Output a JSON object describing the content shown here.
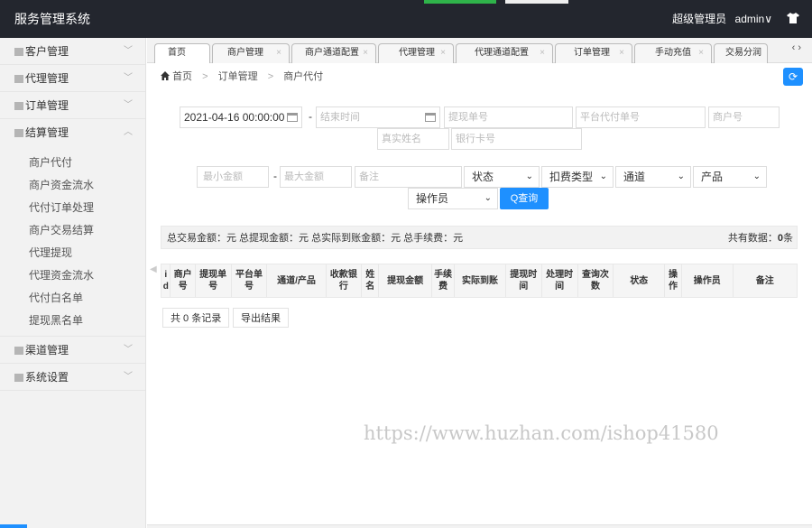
{
  "header": {
    "title": "服务管理系统",
    "user": "超级管理员",
    "username": "admin∨",
    "shirt_icon": "shirt-icon"
  },
  "sidebar": {
    "groups": [
      {
        "label": "客户管理"
      },
      {
        "label": "代理管理"
      },
      {
        "label": "订单管理"
      },
      {
        "label": "结算管理"
      },
      {
        "label": "渠道管理"
      },
      {
        "label": "系统设置"
      }
    ],
    "sub_items": [
      "商户代付",
      "商户资金流水",
      "代付订单处理",
      "商户交易结算",
      "代理提现",
      "代理资金流水",
      "代付白名单",
      "提现黑名单"
    ]
  },
  "tabs": [
    "首页",
    "商户管理",
    "商户通道配置",
    "代理管理",
    "代理通道配置",
    "订单管理",
    "手动充值",
    "交易分润"
  ],
  "tab_nav": "‹  ›",
  "breadcrumb": {
    "home": "首页",
    "sep": ">",
    "level1": "订单管理",
    "level2": "商户代付"
  },
  "filters": {
    "start_time": "2021-04-16 00:00:00",
    "end_time_placeholder": "结束时间",
    "withdraw_no": "提现单号",
    "platform_no": "平台代付单号",
    "merchant_no": "商户号",
    "real_name": "真实姓名",
    "bank_card": "银行卡号",
    "min_amount": "最小金额",
    "max_amount": "最大金额",
    "remark": "备注",
    "status": "状态",
    "fee_type": "扣费类型",
    "channel": "通道",
    "product": "产品",
    "operator": "操作员",
    "dash": "-",
    "query_button": "Q查询"
  },
  "stats": {
    "text": "总交易金额：元   总提现金额：元   总实际到账金额：元   总手续费：元",
    "count_label": "共有数据：",
    "count": "0",
    "unit": "条"
  },
  "table": {
    "headers": [
      "i d",
      "商户号",
      "提现单号",
      "平台单号",
      "通道/产品",
      "收款银行",
      "姓名",
      "提现金额",
      "手续费",
      "实际到账",
      "提现时间",
      "处理时间",
      "查询次数",
      "状态",
      "操作",
      "操作员",
      "备注"
    ]
  },
  "footer": {
    "record_count": "共 0 条记录",
    "export": "导出结果"
  },
  "watermark": "https://www.huzhan.com/ishop41580",
  "colors": {
    "header_bg": "#23262e",
    "accent": "#1e90ff"
  }
}
